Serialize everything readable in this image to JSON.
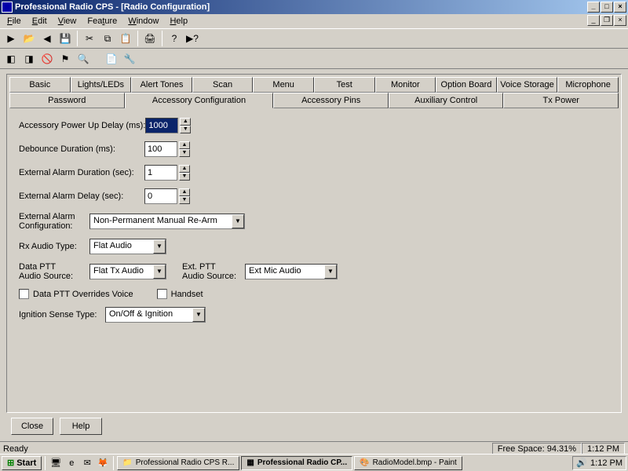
{
  "window": {
    "title": "Professional Radio CPS - [Radio Configuration]"
  },
  "menu": {
    "file": "File",
    "edit": "Edit",
    "view": "View",
    "feature": "Feature",
    "window": "Window",
    "help": "Help"
  },
  "tabs_row1": {
    "basic": "Basic",
    "lights": "Lights/LEDs",
    "alert": "Alert Tones",
    "scan": "Scan",
    "menu": "Menu",
    "test": "Test",
    "monitor": "Monitor",
    "option_board": "Option Board",
    "voice_storage": "Voice Storage",
    "microphone": "Microphone"
  },
  "tabs_row2": {
    "password": "Password",
    "accessory_config": "Accessory Configuration",
    "accessory_pins": "Accessory Pins",
    "aux_control": "Auxiliary Control",
    "tx_power": "Tx Power"
  },
  "form": {
    "powerup_label": "Accessory Power Up Delay (ms):",
    "powerup_value": "1000",
    "debounce_label": "Debounce Duration (ms):",
    "debounce_value": "100",
    "ext_alarm_dur_label": "External Alarm Duration (sec):",
    "ext_alarm_dur_value": "1",
    "ext_alarm_delay_label": "External Alarm Delay (sec):",
    "ext_alarm_delay_value": "0",
    "ext_alarm_cfg_label": "External Alarm\nConfiguration:",
    "ext_alarm_cfg_value": "Non-Permanent Manual Re-Arm",
    "rx_audio_label": "Rx Audio Type:",
    "rx_audio_value": "Flat Audio",
    "data_ptt_src_label": "Data PTT\nAudio Source:",
    "data_ptt_src_value": "Flat Tx Audio",
    "ext_ptt_src_label": "Ext. PTT\nAudio Source:",
    "ext_ptt_src_value": "Ext Mic Audio",
    "data_ptt_override_label": "Data PTT Overrides Voice",
    "handset_label": "Handset",
    "ignition_label": "Ignition Sense Type:",
    "ignition_value": "On/Off & Ignition"
  },
  "buttons": {
    "close": "Close",
    "help": "Help"
  },
  "status": {
    "ready": "Ready",
    "freespace": "Free Space:  94.31%",
    "time1": "1:12 PM"
  },
  "taskbar": {
    "start": "Start",
    "task1": "Professional Radio CPS R...",
    "task2": "Professional Radio CP...",
    "task3": "RadioModel.bmp - Paint",
    "clock": "1:12 PM"
  }
}
